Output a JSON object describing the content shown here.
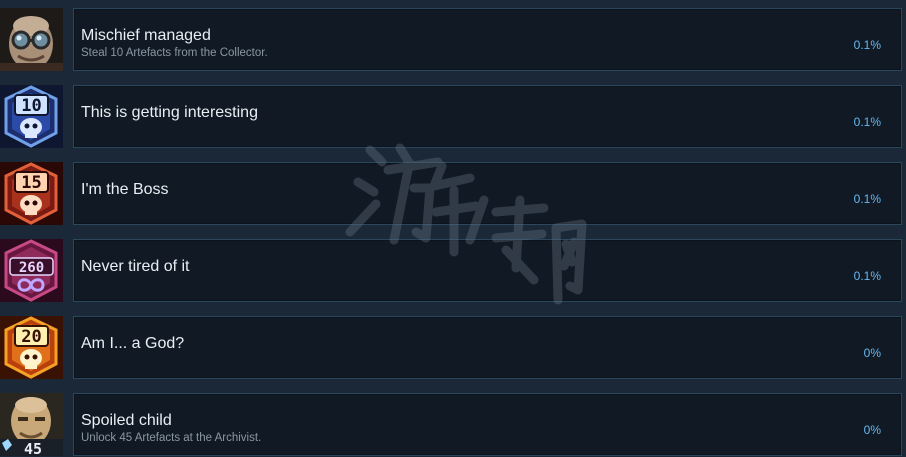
{
  "achievements": [
    {
      "title": "Mischief managed",
      "description": "Steal 10 Artefacts from the Collector.",
      "percent": "0.1%",
      "icon": "goggled-old-man-portrait-icon",
      "icon_colors": {
        "bg": "#1e1a18",
        "main": "#b9a58f",
        "accent": "#6f8fa0"
      }
    },
    {
      "title": "This is getting interesting",
      "description": "",
      "percent": "0.1%",
      "icon": "skull-badge-10-icon",
      "icon_number": "10",
      "icon_colors": {
        "bg": "#1d2e6e",
        "main": "#6fa0e8",
        "accent": "#cfe2ff"
      }
    },
    {
      "title": "I'm the Boss",
      "description": "",
      "percent": "0.1%",
      "icon": "skull-badge-15-icon",
      "icon_number": "15",
      "icon_colors": {
        "bg": "#7a1a12",
        "main": "#e0603a",
        "accent": "#ffd2b0"
      }
    },
    {
      "title": "Never tired of it",
      "description": "",
      "percent": "0.1%",
      "icon": "infinity-badge-260-icon",
      "icon_number": "260",
      "icon_colors": {
        "bg": "#6a1740",
        "main": "#c54a86",
        "accent": "#e8d6ff"
      }
    },
    {
      "title": "Am I... a God?",
      "description": "",
      "percent": "0%",
      "icon": "skull-badge-20-icon",
      "icon_number": "20",
      "icon_colors": {
        "bg": "#b8400c",
        "main": "#f6a126",
        "accent": "#fff0b0"
      }
    },
    {
      "title": "Spoiled child",
      "description": "Unlock 45 Artefacts at the Archivist.",
      "percent": "0%",
      "icon": "bald-man-portrait-45-icon",
      "icon_number": "45",
      "icon_colors": {
        "bg": "#2a2620",
        "main": "#c8a878",
        "accent": "#9fd8ff"
      }
    }
  ],
  "watermark_text": "游侠网"
}
